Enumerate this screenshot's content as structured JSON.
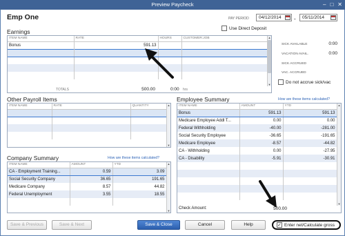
{
  "window": {
    "title": "Preview Paycheck"
  },
  "employee": {
    "name": "Emp One"
  },
  "pay_period": {
    "label": "PAY PERIOD",
    "start": "04/12/2014",
    "end": "05/11/2014",
    "separator": "-"
  },
  "direct_deposit": {
    "label": "Use Direct Deposit",
    "checked": false
  },
  "earnings": {
    "title": "Earnings",
    "columns": [
      "ITEM NAME",
      "RATE",
      "HOURS",
      "CUSTOMER:JOB"
    ],
    "rows": [
      {
        "item": "Bonus",
        "rate": "591.13",
        "hours": "",
        "job": ""
      }
    ],
    "totals_label": "TOTALS",
    "total_amount": "500.00",
    "total_hours": "0:00",
    "hrs_label": "hrs"
  },
  "accruals": {
    "sick_available": {
      "label": "SICK AVAILABLE",
      "value": "0:00"
    },
    "vacation_avail": {
      "label": "VACATION AVAIL.",
      "value": "0:00"
    },
    "sick_accrued": {
      "label": "SICK ACCRUED",
      "value": ""
    },
    "vac_accrued": {
      "label": "VAC. ACCRUED",
      "value": ""
    },
    "no_accrue": {
      "label": "Do not accrue sick/vac",
      "checked": false
    }
  },
  "other_payroll": {
    "title": "Other Payroll Items",
    "columns": [
      "ITEM NAME",
      "RATE",
      "QUANTITY"
    ]
  },
  "employee_summary": {
    "title": "Employee Summary",
    "calc_link": "How are these items calculated?",
    "columns": [
      "ITEM NAME",
      "AMOUNT",
      "YTD"
    ],
    "rows": [
      {
        "item": "Bonus",
        "amount": "591.13",
        "ytd": "591.13"
      },
      {
        "item": "Medicare Employee Addl T...",
        "amount": "0.00",
        "ytd": "0.00"
      },
      {
        "item": "Federal Withholding",
        "amount": "-40.00",
        "ytd": "-281.00"
      },
      {
        "item": "Social Security Employee",
        "amount": "-36.65",
        "ytd": "-191.65"
      },
      {
        "item": "Medicare Employee",
        "amount": "-8.57",
        "ytd": "-44.82"
      },
      {
        "item": "CA - Withholding",
        "amount": "0.00",
        "ytd": "-27.95"
      },
      {
        "item": "CA - Disability",
        "amount": "-5.91",
        "ytd": "-30.91"
      }
    ],
    "check_amount_label": "Check Amount:",
    "check_amount": "500.00"
  },
  "company_summary": {
    "title": "Company Summary",
    "calc_link": "How are these items calculated?",
    "columns": [
      "ITEM NAME",
      "AMOUNT",
      "YTD"
    ],
    "rows": [
      {
        "item": "CA - Employment Training...",
        "amount": "0.59",
        "ytd": "3.09"
      },
      {
        "item": "Social Security Company",
        "amount": "36.65",
        "ytd": "191.65"
      },
      {
        "item": "Medicare Company",
        "amount": "8.57",
        "ytd": "44.82"
      },
      {
        "item": "Federal Unemployment",
        "amount": "3.55",
        "ytd": "18.55"
      }
    ]
  },
  "buttons": {
    "save_previous": "Save & Previous",
    "save_next": "Save & Next",
    "save_close": "Save & Close",
    "cancel": "Cancel",
    "help": "Help"
  },
  "enter_net": {
    "label": "Enter net/Calculate gross",
    "checked": true
  },
  "colors": {
    "titlebar": "#3f6396",
    "selection": "#3a78d0",
    "link": "#2d63b7",
    "band": "#e6ecf6"
  }
}
